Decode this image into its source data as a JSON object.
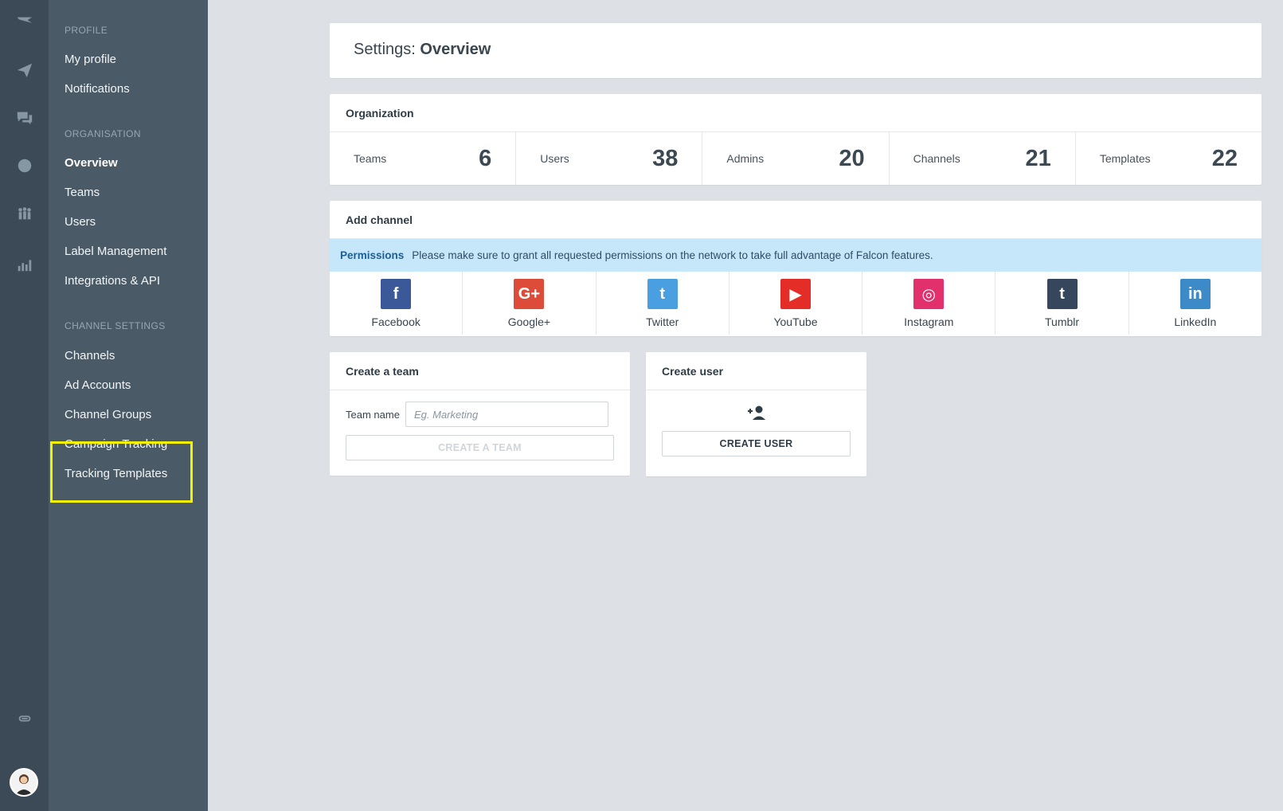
{
  "sidebar": {
    "sections": [
      {
        "title": "PROFILE",
        "items": [
          "My profile",
          "Notifications"
        ]
      },
      {
        "title": "ORGANISATION",
        "items": [
          "Overview",
          "Teams",
          "Users",
          "Label Management",
          "Integrations & API"
        ]
      },
      {
        "title": "CHANNEL SETTINGS",
        "items": [
          "Channels",
          "Ad Accounts",
          "Channel Groups",
          "Campaign Tracking",
          "Tracking Templates"
        ]
      }
    ],
    "active_item": "Overview"
  },
  "rail_icons": [
    "logo-icon",
    "paper-plane-icon",
    "chat-icon",
    "globe-icon",
    "people-icon",
    "bar-chart-icon",
    "link-icon"
  ],
  "header": {
    "title_prefix": "Settings:",
    "title_main": "Overview"
  },
  "organization": {
    "title": "Organization",
    "stats": [
      {
        "label": "Teams",
        "value": "6"
      },
      {
        "label": "Users",
        "value": "38"
      },
      {
        "label": "Admins",
        "value": "20"
      },
      {
        "label": "Channels",
        "value": "21"
      },
      {
        "label": "Templates",
        "value": "22"
      }
    ]
  },
  "add_channel": {
    "title": "Add channel",
    "permissions_label": "Permissions",
    "permissions_text": "Please make sure to grant all requested permissions on the network to take full advantage of Falcon features.",
    "networks": [
      {
        "label": "Facebook",
        "glyph": "f",
        "color": "#3b5998"
      },
      {
        "label": "Google+",
        "glyph": "G+",
        "color": "#dd4b39"
      },
      {
        "label": "Twitter",
        "glyph": "t",
        "color": "#4a9fe0"
      },
      {
        "label": "YouTube",
        "glyph": "▶",
        "color": "#e52d27"
      },
      {
        "label": "Instagram",
        "glyph": "◎",
        "color": "#e1306c"
      },
      {
        "label": "Tumblr",
        "glyph": "t",
        "color": "#36465d"
      },
      {
        "label": "LinkedIn",
        "glyph": "in",
        "color": "#3c8bc8"
      }
    ]
  },
  "create_team": {
    "title": "Create a team",
    "field_label": "Team name",
    "placeholder": "Eg. Marketing",
    "button": "CREATE A TEAM"
  },
  "create_user": {
    "title": "Create user",
    "button": "CREATE USER"
  },
  "colors": {
    "highlight": "#f4f200",
    "rail": "#3b4a56",
    "sidebar": "#4a5a66",
    "permissions_bg": "#c6e6fa"
  }
}
